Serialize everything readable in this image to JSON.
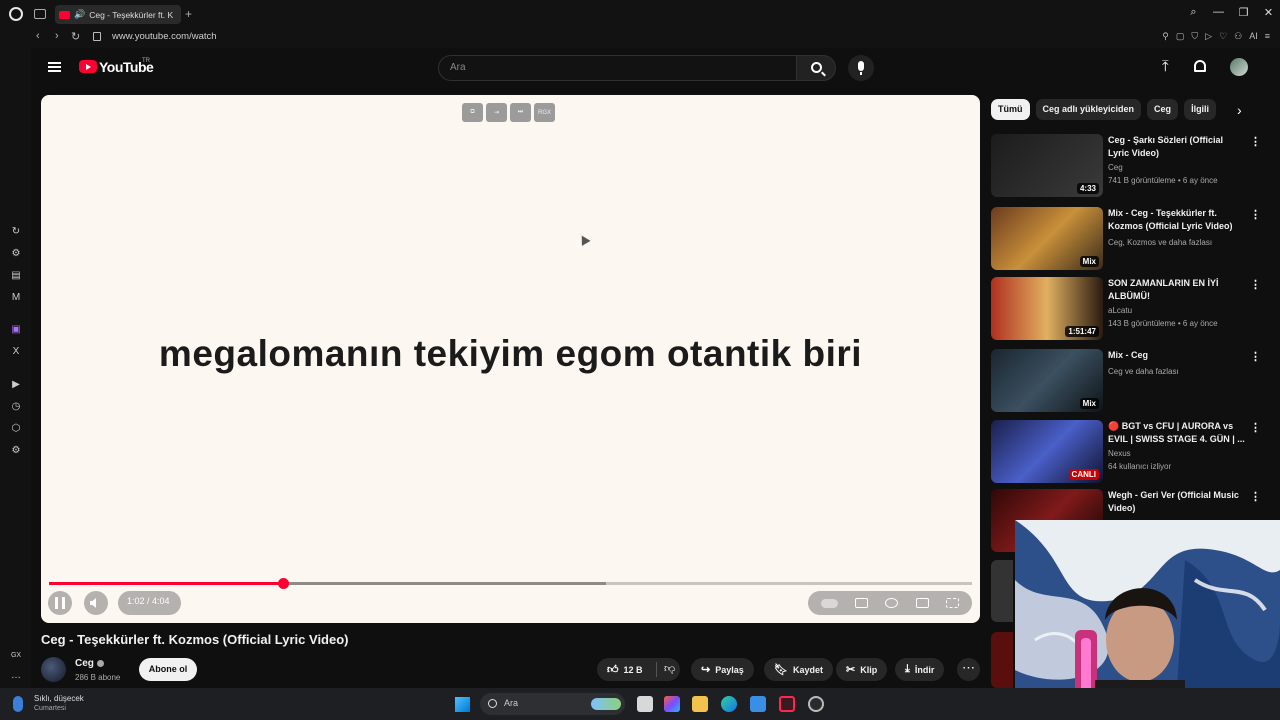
{
  "browser": {
    "tab_title": "Ceg - Teşekkürler ft. K",
    "url": "www.youtube.com/watch",
    "ai_label": "AI"
  },
  "youtube": {
    "logo_text": "YouTube",
    "region": "TR",
    "search_placeholder": "Ara"
  },
  "player": {
    "overlay_label": "RGX",
    "lyric": "megalomanın tekiyim egom otantik biri",
    "time": "1:02 / 4:04",
    "progress_fraction": 0.254,
    "buffer_fraction": 0.604
  },
  "video": {
    "title": "Ceg - Teşekkürler ft. Kozmos (Official Lyric Video)",
    "channel": "Ceg",
    "subscribers": "286 B abone",
    "subscribe_label": "Abone ol",
    "likes": "12 B",
    "share_label": "Paylaş",
    "save_label": "Kaydet",
    "clip_label": "Klip",
    "download_label": "İndir"
  },
  "chips": [
    "Tümü",
    "Ceg adlı yükleyiciden",
    "Ceg",
    "İlgili"
  ],
  "recommendations": [
    {
      "title": "Ceg - Şarkı Sözleri (Official Lyric Video)",
      "channel": "Ceg",
      "meta": "741 B görüntüleme • 6 ay önce",
      "badge": "4:33"
    },
    {
      "title": "Mix - Ceg - Teşekkürler ft. Kozmos (Official Lyric Video)",
      "channel": "Ceg, Kozmos ve daha fazlası",
      "meta": "",
      "badge": "Mix"
    },
    {
      "title": "SON ZAMANLARIN EN İYİ ALBÜMÜ!",
      "channel": "aLcatu",
      "meta": "143 B görüntüleme • 6 ay önce",
      "badge": "1:51:47"
    },
    {
      "title": "Mix - Ceg",
      "channel": "Ceg ve daha fazlası",
      "meta": "",
      "badge": "Mix"
    },
    {
      "title": "🔴 BGT vs CFU | AURORA vs EVIL | SWISS STAGE 4. GÜN | ...",
      "channel": "Nexus",
      "meta": "64 kullanıcı izliyor",
      "badge": "CANLI"
    },
    {
      "title": "Wegh - Geri Ver (Official Music Video)",
      "channel": "",
      "meta": "",
      "badge": ""
    }
  ],
  "taskbar": {
    "weather_line1": "Sıklı, düşecek",
    "weather_line2": "Cumartesi",
    "search_text": "Ara"
  },
  "colors": {
    "accent": "#ff0033",
    "background": "#0f0f0f",
    "player_bg": "#fdf7f1"
  }
}
